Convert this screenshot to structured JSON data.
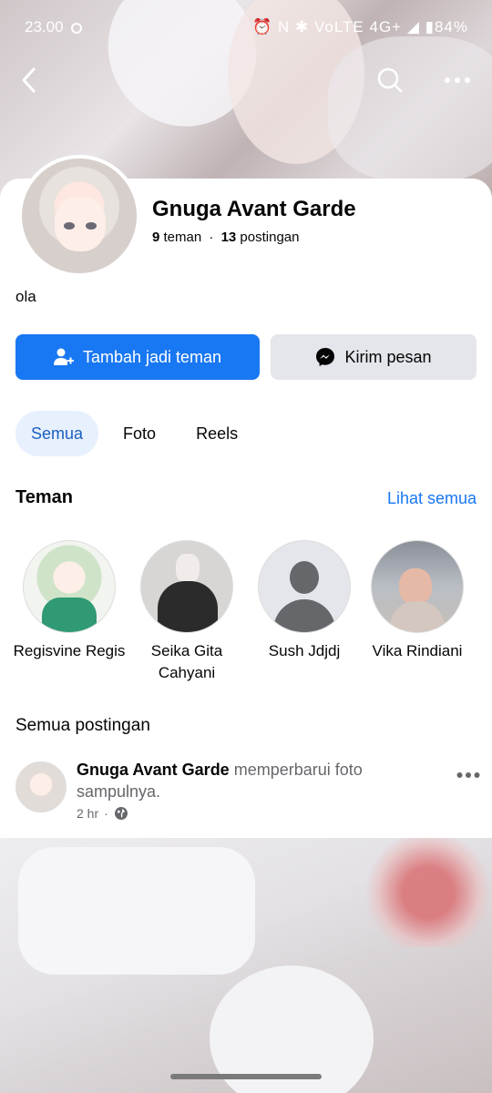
{
  "status_bar": {
    "time": "23.00",
    "indicators": "⏰ N ✱ VoLTE 4G+ ◢ ▮84%"
  },
  "top_bar": {
    "back_icon": "chevron-left-icon",
    "search_icon": "search-icon",
    "more_icon": "more-horizontal-icon"
  },
  "profile": {
    "name": "Gnuga Avant Garde",
    "friends_count": "9",
    "friends_label": "teman",
    "separator": "·",
    "posts_count": "13",
    "posts_label": "postingan",
    "bio": "ola"
  },
  "actions": {
    "add_friend_label": "Tambah jadi teman",
    "message_label": "Kirim pesan"
  },
  "tabs": [
    {
      "label": "Semua",
      "active": true
    },
    {
      "label": "Foto",
      "active": false
    },
    {
      "label": "Reels",
      "active": false
    }
  ],
  "friends_section": {
    "title": "Teman",
    "see_all": "Lihat semua",
    "friends": [
      {
        "name": "Regisvine Regis"
      },
      {
        "name": "Seika Gita Cahyani"
      },
      {
        "name": "Sush Jdjdj"
      },
      {
        "name": "Vika Rindiani"
      }
    ]
  },
  "posts_section": {
    "title": "Semua postingan",
    "post": {
      "author": "Gnuga Avant Garde",
      "action": "memperbarui foto sampulnya.",
      "time": "2 hr",
      "dot": "·",
      "privacy_icon": "globe-icon"
    }
  },
  "colors": {
    "primary": "#1877f2",
    "secondary_button": "#e4e6eb",
    "active_tab_bg": "#e7f0fd"
  }
}
